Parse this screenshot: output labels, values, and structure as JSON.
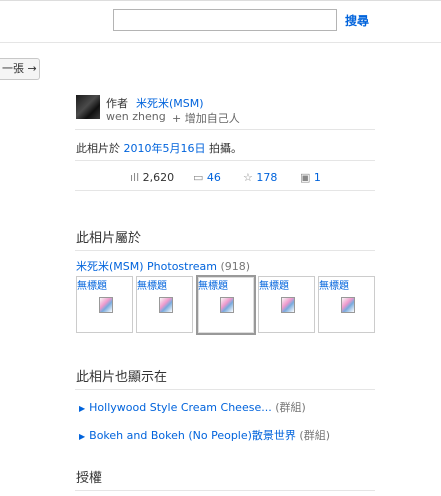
{
  "header": {
    "search_placeholder": "",
    "search_label": "搜尋"
  },
  "nav": {
    "prev_label": "一張 →"
  },
  "owner": {
    "label": "作者",
    "name": "米死米(MSM)",
    "real_name": "wen zheng",
    "add_self": "+ 增加自己人"
  },
  "taken": {
    "prefix": "此相片於",
    "date": "2010年5月16日",
    "suffix": "拍攝。"
  },
  "stats": {
    "views": "2,620",
    "comments": "46",
    "favorites": "178",
    "notes": "1"
  },
  "belongs": {
    "heading": "此相片屬於",
    "stream_name": "米死米(MSM) Photostream",
    "stream_count": "(918)",
    "thumbs": [
      "無標題",
      "無標題",
      "無標題",
      "無標題",
      "無標題"
    ]
  },
  "appears": {
    "heading": "此相片也顯示在",
    "items": [
      {
        "name": "Hollywood Style Cream Cheese...",
        "kind": "(群組)"
      },
      {
        "name": "Bokeh and Bokeh (No People)散景世界",
        "kind": "(群組)"
      }
    ]
  },
  "license": {
    "heading": "授權"
  }
}
